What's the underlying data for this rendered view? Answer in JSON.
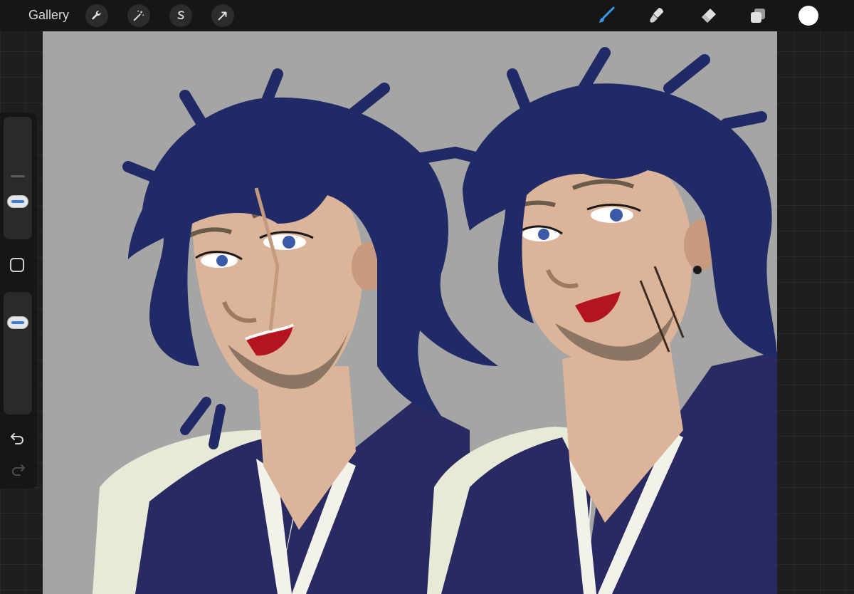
{
  "topbar": {
    "gallery_label": "Gallery",
    "left_tools": [
      "wrench-icon",
      "magic-wand-icon",
      "selection-icon",
      "transform-arrow-icon"
    ],
    "right_tools": [
      "brush-icon",
      "smudge-icon",
      "eraser-icon",
      "layers-icon"
    ],
    "active_tool": "brush",
    "accent_color": "#3a9be8",
    "current_color": "#ffffff"
  },
  "sidebar": {
    "brush_size": 0.5,
    "brush_opacity": 1.0,
    "controls": [
      "brush-size-slider",
      "modify-button",
      "brush-opacity-slider",
      "undo-icon",
      "redo-icon"
    ]
  },
  "canvas": {
    "background": "#a5a5a5",
    "palette": {
      "hair": "#1f2a66",
      "robe": "#2a2a62",
      "skin": "#dcb49a",
      "white_fabric": "#e8ead8",
      "mouth": "#b3141e",
      "eye": "#3a5aa8"
    }
  }
}
